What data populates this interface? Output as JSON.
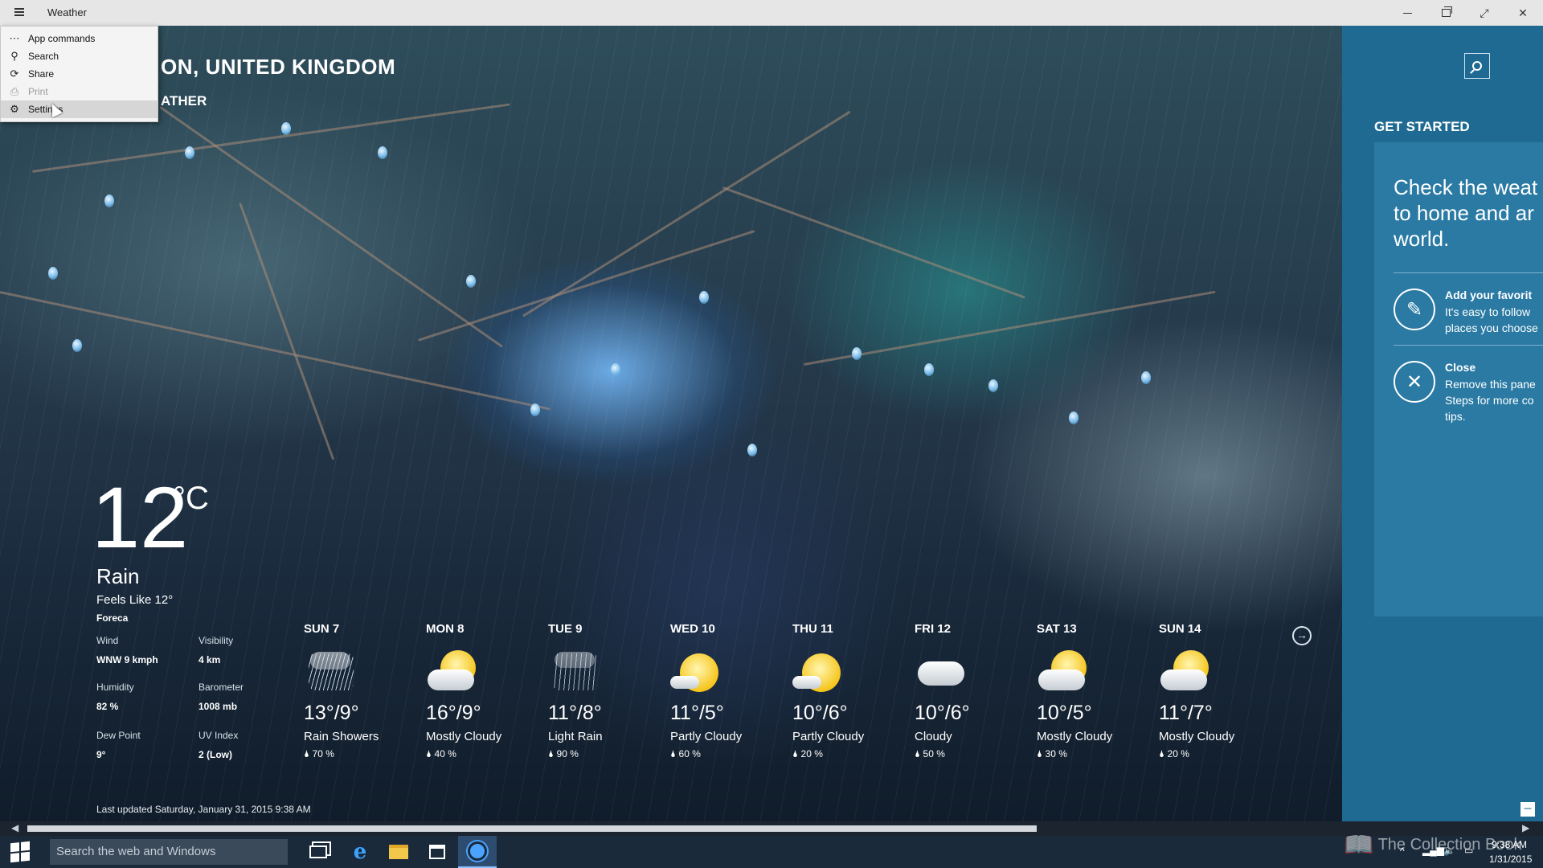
{
  "window": {
    "app_title": "Weather"
  },
  "location": {
    "title": "ON, UNITED KINGDOM",
    "subtitle": "ATHER"
  },
  "flyout": {
    "items": [
      {
        "label": "App commands",
        "icon": "more-icon",
        "enabled": true
      },
      {
        "label": "Search",
        "icon": "search-icon",
        "enabled": true
      },
      {
        "label": "Share",
        "icon": "share-icon",
        "enabled": true
      },
      {
        "label": "Print",
        "icon": "print-icon",
        "enabled": false
      },
      {
        "label": "Settings",
        "icon": "gear-icon",
        "enabled": true
      }
    ]
  },
  "current": {
    "temp": "12",
    "unit": "°C",
    "condition": "Rain",
    "feels_like": "Feels Like 12°",
    "provider": "Foreca",
    "details": [
      {
        "label": "Wind",
        "value": "WNW 9 kmph"
      },
      {
        "label": "Visibility",
        "value": "4 km"
      },
      {
        "label": "Humidity",
        "value": "82 %"
      },
      {
        "label": "Barometer",
        "value": "1008 mb"
      },
      {
        "label": "Dew Point",
        "value": "9°"
      },
      {
        "label": "UV Index",
        "value": "2 (Low)"
      }
    ]
  },
  "forecast": [
    {
      "day": "SUN 7",
      "temps": "13°/9°",
      "condition": "Rain Showers",
      "precip": "70 %",
      "icon": "rain-showers-icon"
    },
    {
      "day": "MON 8",
      "temps": "16°/9°",
      "condition": "Mostly Cloudy",
      "precip": "40 %",
      "icon": "mostly-cloudy-icon"
    },
    {
      "day": "TUE 9",
      "temps": "11°/8°",
      "condition": "Light Rain",
      "precip": "90 %",
      "icon": "light-rain-icon"
    },
    {
      "day": "WED 10",
      "temps": "11°/5°",
      "condition": "Partly Cloudy",
      "precip": "60 %",
      "icon": "partly-cloudy-icon"
    },
    {
      "day": "THU 11",
      "temps": "10°/6°",
      "condition": "Partly Cloudy",
      "precip": "20 %",
      "icon": "partly-cloudy-icon"
    },
    {
      "day": "FRI 12",
      "temps": "10°/6°",
      "condition": "Cloudy",
      "precip": "50 %",
      "icon": "cloudy-icon"
    },
    {
      "day": "SAT 13",
      "temps": "10°/5°",
      "condition": "Mostly Cloudy",
      "precip": "30 %",
      "icon": "mostly-cloudy-icon"
    },
    {
      "day": "SUN 14",
      "temps": "11°/7°",
      "condition": "Mostly Cloudy",
      "precip": "20 %",
      "icon": "mostly-cloudy-icon"
    }
  ],
  "last_updated": "Last updated Saturday, January 31, 2015 9:38 AM",
  "get_started": {
    "title": "GET STARTED",
    "lead": "Check the weat to home and ar world.",
    "items": [
      {
        "title": "Add your favorit",
        "desc": "It's easy to follow places you choose",
        "icon": "pencil-icon"
      },
      {
        "title": "Close",
        "desc": "Remove this pane Steps for more co tips.",
        "icon": "close-icon"
      }
    ]
  },
  "taskbar": {
    "search_placeholder": "Search the web and Windows",
    "time": "9:38 AM",
    "date": "1/31/2015",
    "watermark": "The Collection Book"
  },
  "colors": {
    "panel": "#1f6a92",
    "panel_card": "#2a7aa4",
    "titlebar": "#e6e6e6",
    "taskbar": "#1a2a3a"
  }
}
